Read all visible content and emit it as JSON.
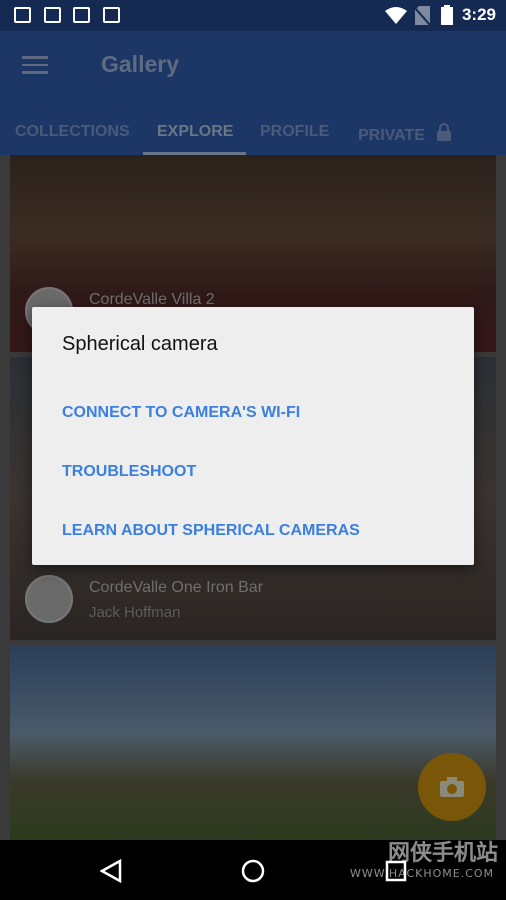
{
  "status_bar": {
    "time": "3:29",
    "icons": [
      "image-icon",
      "gmail-stack-icon",
      "gmail-icon",
      "clipboard-check-icon",
      "wifi-icon",
      "no-sim-icon",
      "battery-icon"
    ]
  },
  "app_bar": {
    "title": "Gallery",
    "menu_icon": "hamburger-icon"
  },
  "tabs": [
    {
      "label": "COLLECTIONS"
    },
    {
      "label": "EXPLORE",
      "active": true
    },
    {
      "label": "PROFILE"
    },
    {
      "label": "PRIVATE",
      "icon": "lock-icon"
    }
  ],
  "cards": [
    {
      "title": "CordeValle Villa 2"
    },
    {
      "title": "CordeValle One Iron Bar",
      "author": "Jack Hoffman"
    },
    {}
  ],
  "dialog": {
    "title": "Spherical camera",
    "options": [
      "CONNECT TO CAMERA'S WI-FI",
      "TROUBLESHOOT",
      "LEARN ABOUT SPHERICAL CAMERAS"
    ]
  },
  "fab": {
    "icon": "camera-icon"
  },
  "watermark": {
    "text_cn": "网侠手机站",
    "text_url": "WWW.HACKHOME.COM"
  },
  "colors": {
    "accent": "#3b7fe0",
    "app_bar": "#1c3765",
    "fab": "#f4a90f"
  }
}
